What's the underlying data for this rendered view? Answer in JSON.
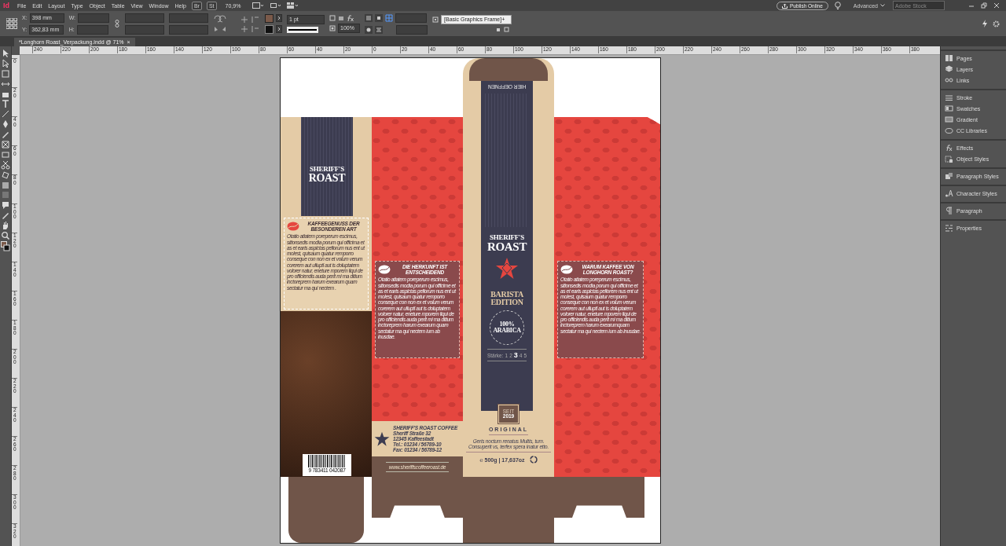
{
  "menu_bar": {
    "app_logo": "Id",
    "menus": [
      "File",
      "Edit",
      "Layout",
      "Type",
      "Object",
      "Table",
      "View",
      "Window",
      "Help"
    ],
    "bridge": "Br",
    "stock": "St",
    "zoom": "70,9%",
    "publish_button": "Publish Online",
    "workspace": "Advanced",
    "search": {
      "placeholder": "Adobe Stock"
    }
  },
  "control_bar": {
    "x_label": "X:",
    "x_value": "398 mm",
    "y_label": "Y:",
    "y_value": "362,83 mm",
    "w_label": "W:",
    "h_label": "H:",
    "stroke_weight": "1 pt",
    "scale": "100%",
    "object_style": "[Basic Graphics Frame]+"
  },
  "document_tab": {
    "title": "*Longhorn Roast_Verpackung.indd @ 71%",
    "close": "×"
  },
  "ruler": {
    "horizontal": [
      "240",
      "220",
      "200",
      "180",
      "160",
      "140",
      "120",
      "100",
      "80",
      "60",
      "40",
      "20",
      "0",
      "20",
      "40",
      "60",
      "80",
      "100",
      "120",
      "140",
      "160",
      "180",
      "200",
      "220",
      "240",
      "260",
      "280",
      "300",
      "320",
      "340",
      "360",
      "380"
    ],
    "vertical": [
      "0",
      "20",
      "40",
      "60",
      "80",
      "100",
      "120",
      "140",
      "160",
      "180",
      "200",
      "220",
      "240",
      "260",
      "280",
      "300",
      "320"
    ]
  },
  "panels": [
    {
      "items": [
        "Pages",
        "Layers",
        "Links"
      ]
    },
    {
      "items": [
        "Stroke",
        "Swatches",
        "Gradient",
        "CC Libraries"
      ]
    },
    {
      "items": [
        "Effects",
        "Object Styles"
      ]
    },
    {
      "items": [
        "Paragraph Styles"
      ]
    },
    {
      "items": [
        "Character Styles"
      ]
    },
    {
      "items": [
        "Paragraph"
      ]
    },
    {
      "items": [
        "Properties"
      ]
    }
  ],
  "artwork": {
    "side_label": {
      "brand_line_1": "SHERIFF'S",
      "brand_line_2": "ROAST"
    },
    "side_text": {
      "heading": "KAFFEEGENUSS DER BESONDEREN ART",
      "body": "Otatio atiatem poreperum escimus, sitionsedis modia porum qui officima et as et earis aspictas pellorum nus ent ut molest, quisaum quatur remporro conseque con non ex et volum verum corerem aut ulluptl aut is doluptatem volorer natur, eneture mporem liqui de pro officiendis auda perit mi ma ditium inctoreprem harum exearum quam sectatur ma qui nectem ."
    },
    "barcode_digits": "9 783411 042087",
    "origin_text": {
      "heading": "DIE HERKUNFT IST ENTSCHEIDEND",
      "body": "Otatio atiatem poreperum escimus, sitionsedis modia porum qui officime et as et earis aspictas pellorum nus ent ut molest, quisaum quatur remporro conseque con non ex et volum verum corerem aut ulluptl aut is doluptatem volorer natur, eneture mporem liqui de pro officiendis auda perit mi ma ditium inctoreprem harum exearum quam sectatur ma qui nectem ium ab inusdae."
    },
    "address": [
      "SHERIFF'S ROAST COFFEE",
      "Sheriff Straße 32",
      "12345 Kaffeestadt",
      "Tel.: 01234 / 56789-10",
      "Fax: 01234 / 56789-12"
    ],
    "website": "www.sheriffscoffeeroast.de",
    "front": {
      "open_here": "HIER OEFFNEN",
      "brand_line_1": "SHERIFF'S",
      "brand_line_2": "ROAST",
      "edition_line_1": "BARISTA",
      "edition_line_2": "EDITION",
      "seal_line_1": "100%",
      "seal_line_2": "ARABICA",
      "strength_label": "Stärke:",
      "strength": [
        {
          "label": "1",
          "selected": false
        },
        {
          "label": "2",
          "selected": false
        },
        {
          "label": "3",
          "selected": true
        },
        {
          "label": "4",
          "selected": false
        },
        {
          "label": "5",
          "selected": false
        }
      ],
      "since": "SEIT",
      "year": "2019",
      "variety": "ORIGINAL",
      "tagline": "Geris noctum renatus Multis, tum. Consuperit vs, terfex spera inatur etto.",
      "weight": "℮ 500g | 17,637oz"
    },
    "why_text": {
      "heading": "WARUM KAFFEE VON LONGHORN ROAST?",
      "body": "Otatio atiatem poreperum escimus, sitionsedis modia porum qui officime et as et earis aspictas pellorem nus ent ut molest, quisaum quatur remporro conseque con non ex et volum verum corerem aut ulluptl aut is doluptatem volorer natur, eneture mporem liqui de pro officiendis auda perit mi ma ditium inctoreprem harum exearumquam sectatur ma qui nectem ium ab inusdae."
    }
  }
}
